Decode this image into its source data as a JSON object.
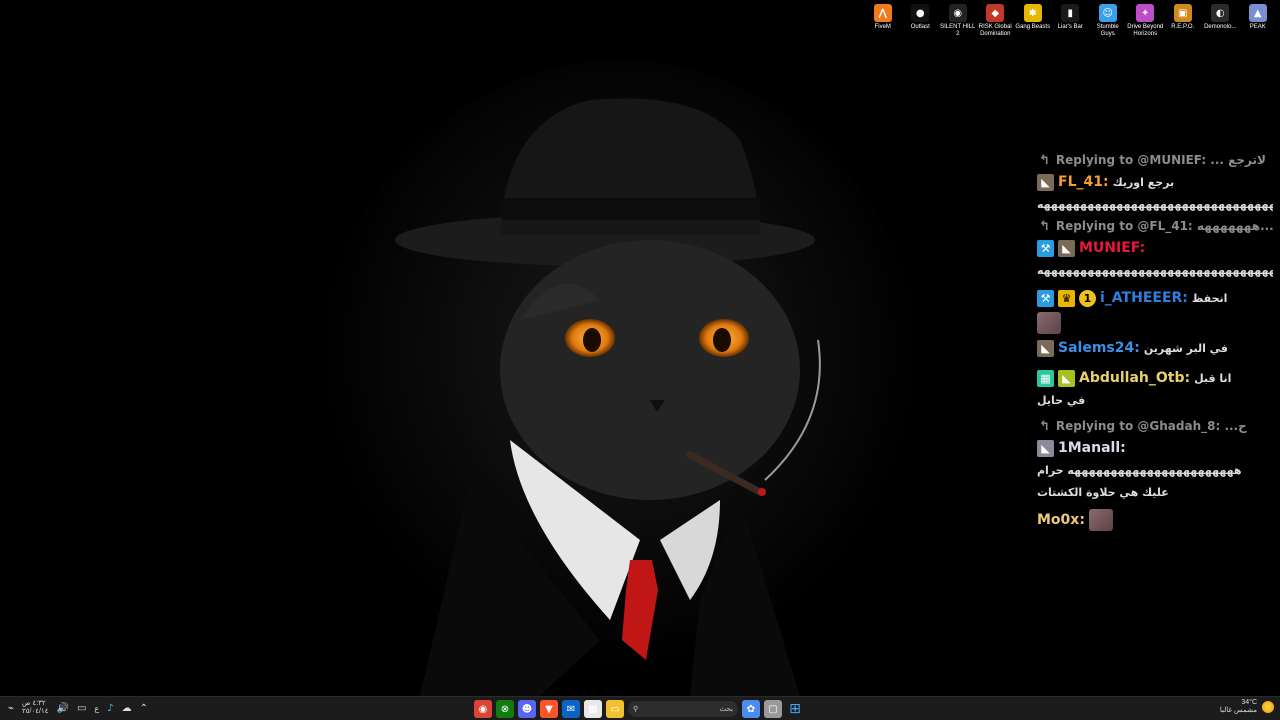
{
  "desktop_icons": [
    {
      "label": "FiveM",
      "icon": "fivem-icon",
      "color": "#f07b1d",
      "glyph": "⋀"
    },
    {
      "label": "Outlast",
      "icon": "outlast-icon",
      "color": "#111111",
      "glyph": "●"
    },
    {
      "label": "SILENT HILL 2",
      "icon": "silent-hill-icon",
      "color": "#222222",
      "glyph": "◉"
    },
    {
      "label": "RISK Global Domination",
      "icon": "risk-icon",
      "color": "#c0392b",
      "glyph": "◆"
    },
    {
      "label": "Gang Beasts",
      "icon": "gang-beasts-icon",
      "color": "#e6b800",
      "glyph": "✱"
    },
    {
      "label": "Liar's Bar",
      "icon": "liars-bar-icon",
      "color": "#1a1a1a",
      "glyph": "▮"
    },
    {
      "label": "Stumble Guys",
      "icon": "stumble-guys-icon",
      "color": "#3aa0e8",
      "glyph": "☺"
    },
    {
      "label": "Drive Beyond Horizons",
      "icon": "drive-beyond-horizons-icon",
      "color": "#c04dc8",
      "glyph": "✦"
    },
    {
      "label": "R.E.P.O.",
      "icon": "repo-icon",
      "color": "#d08a1c",
      "glyph": "▣"
    },
    {
      "label": "Demonolo...",
      "icon": "demonologist-icon",
      "color": "#2b2b2b",
      "glyph": "◐"
    },
    {
      "label": "PEAK",
      "icon": "peak-icon",
      "color": "#7a8fd0",
      "glyph": "▲"
    }
  ],
  "chat": {
    "messages": [
      {
        "reply_to": "Replying to @MUNIEF: ... لاترجع",
        "name": "FL_41:",
        "name_color": "#f0a030",
        "badges": [
          "rank-icon"
        ],
        "text": "برجع اوريك",
        "continuation": "ههههههههههههههههههههههههههههههههههههه"
      },
      {
        "reply_to": "Replying to @FL_41: هههههههه...",
        "name": "MUNIEF:",
        "name_color": "#e8173c",
        "badges": [
          "moderator-icon",
          "rank-icon"
        ],
        "text": "",
        "continuation": "ههههههههههههههههههههههههههههههههههههه"
      },
      {
        "reply_to": "",
        "name": "i_ATHEEER:",
        "name_color": "#2f7fe0",
        "badges": [
          "moderator-icon",
          "vip-crown-icon",
          "gifter-icon"
        ],
        "text": "انحفظ",
        "has_emote": true,
        "continuation": ""
      },
      {
        "reply_to": "",
        "name": "Salems24:",
        "name_color": "#3b8fe8",
        "badges": [
          "rank-icon"
        ],
        "text": "في البر شهرين",
        "continuation": ""
      },
      {
        "reply_to": "",
        "name": "Abdullah_Otb:",
        "name_color": "#e8d06a",
        "badges": [
          "og-badge-icon",
          "rank-icon"
        ],
        "text": "انا قبل",
        "continuation": "في حايل"
      },
      {
        "reply_to": "Replying to @Ghadah_8: ...ح",
        "name": "1Manall:",
        "name_color": "#e0d8e8",
        "badges": [
          "rank-icon"
        ],
        "text": "",
        "continuation": "هههههههههههههههههههههههه حرام",
        "continuation2": "عليك هي حلاوة الكشتات"
      },
      {
        "reply_to": "",
        "name": "Mo0x:",
        "name_color": "#f0c87a",
        "badges": [],
        "text": "",
        "has_emote_inline": true,
        "continuation": ""
      }
    ]
  },
  "taskbar": {
    "clock_time": "٤:٣٢ ص",
    "clock_date": "٢٥/٠٤/١٤",
    "lang": "ع",
    "search_placeholder": "بحث",
    "weather_temp": "34°C",
    "weather_desc": "مشمس غالبا",
    "apps": [
      {
        "icon": "chrome-icon",
        "color": "#db4437",
        "glyph": "◉"
      },
      {
        "icon": "xbox-icon",
        "color": "#107c10",
        "glyph": "⊗"
      },
      {
        "icon": "discord-icon",
        "color": "#5865f2",
        "glyph": "☻"
      },
      {
        "icon": "brave-icon",
        "color": "#fb542b",
        "glyph": "▼"
      },
      {
        "icon": "outlook-icon",
        "color": "#0a64c8",
        "glyph": "✉"
      },
      {
        "icon": "calendar-icon",
        "color": "#e8e8e8",
        "glyph": "▦"
      },
      {
        "icon": "file-explorer-icon",
        "color": "#f2c12e",
        "glyph": "▭"
      },
      {
        "icon": "copilot-icon",
        "color": "#4a8cf0",
        "glyph": "✿"
      },
      {
        "icon": "generic-window-icon",
        "color": "#9a9a9a",
        "glyph": "▢"
      }
    ]
  }
}
